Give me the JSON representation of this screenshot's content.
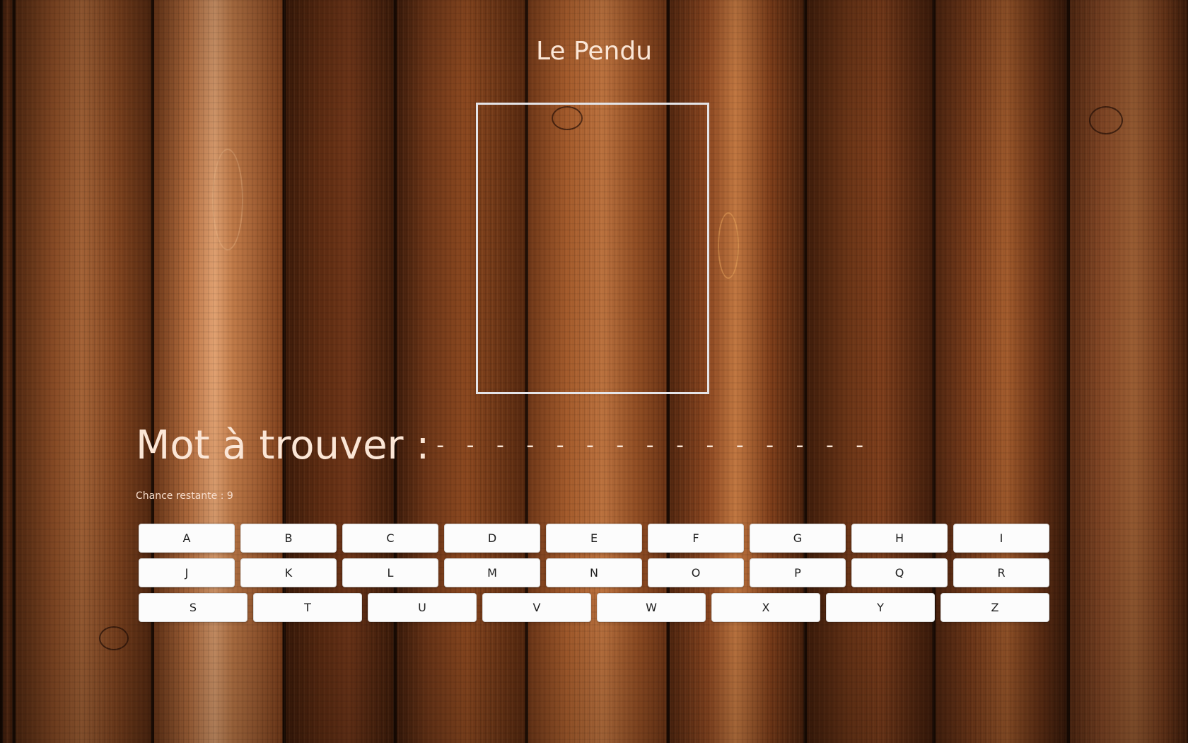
{
  "game": {
    "title": "Le Pendu",
    "word_label": "Mot à trouver :",
    "word_mask": "- - - - - - - - - - - - - - -",
    "chances_text": "Chance restante : 9",
    "chances_remaining": 9
  },
  "keyboard": {
    "row1": [
      "A",
      "B",
      "C",
      "D",
      "E",
      "F",
      "G",
      "H",
      "I"
    ],
    "row2": [
      "J",
      "K",
      "L",
      "M",
      "N",
      "O",
      "P",
      "Q",
      "R"
    ],
    "row3": [
      "S",
      "T",
      "U",
      "V",
      "W",
      "X",
      "Y",
      "Z"
    ]
  },
  "colors": {
    "text_light": "#fbe6d6",
    "gallows_frame": "#e4e4e8",
    "key_background": "#fcfcfc",
    "key_text": "#1e1e1e",
    "wood_dark": "#3a1a0a",
    "wood_mid": "#7a3e1c",
    "wood_light": "#b4683a"
  },
  "background": {
    "description_icon": "wood-planks-background"
  }
}
